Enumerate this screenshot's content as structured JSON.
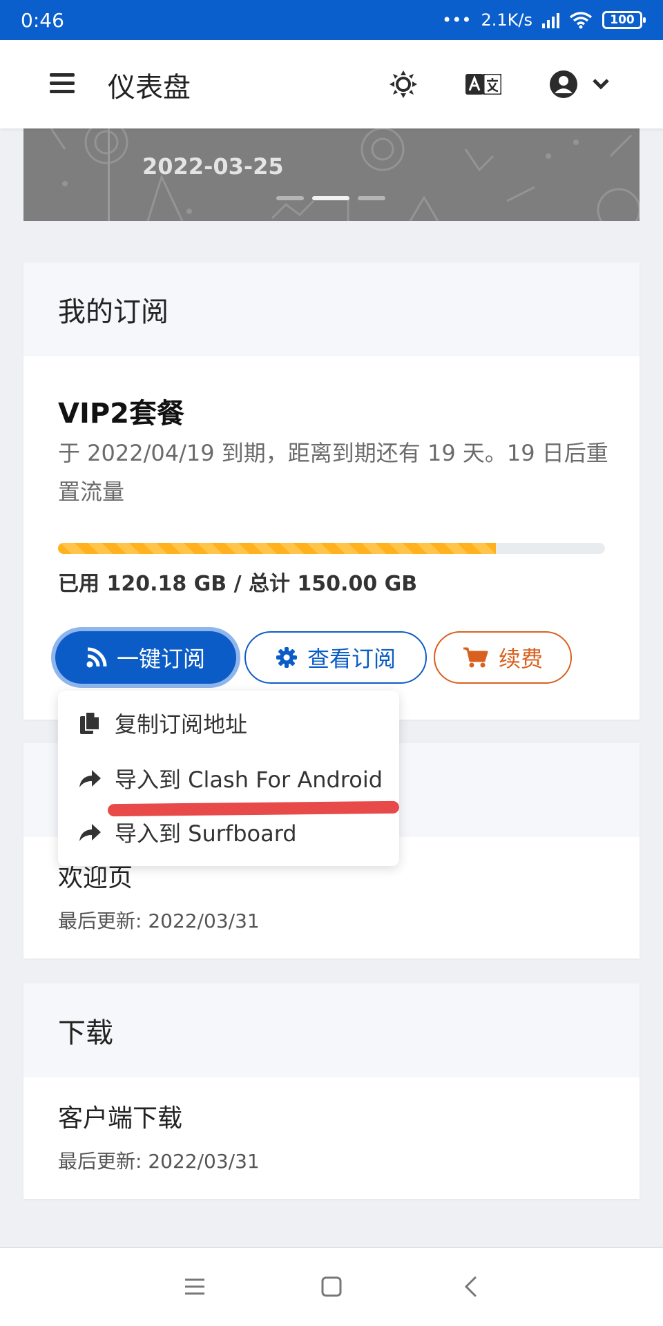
{
  "status_bar": {
    "time": "0:46",
    "network_speed": "2.1K/s",
    "battery": "100"
  },
  "header": {
    "title": "仪表盘",
    "icons": [
      "menu-icon",
      "theme-icon",
      "translate-icon",
      "user-icon",
      "chevron-down-icon"
    ]
  },
  "banner": {
    "date": "2022-03-25"
  },
  "subscription": {
    "title": "我的订阅",
    "plan_name": "VIP2套餐",
    "description": "于 2022/04/19 到期，距离到期还有 19 天。19 日后重置流量",
    "usage_text": "已用 120.18 GB / 总计 150.00 GB",
    "usage_fraction": 0.801,
    "buttons": {
      "subscribe": "一键订阅",
      "view": "查看订阅",
      "renew": "续费"
    }
  },
  "dropdown": {
    "items": [
      {
        "label": "复制订阅地址",
        "icon": "copy-icon"
      },
      {
        "label": "导入到 Clash For Android",
        "icon": "share-icon"
      },
      {
        "label": "导入到 Surfboard",
        "icon": "share-icon"
      }
    ]
  },
  "documents": {
    "item_title": "欢迎页",
    "updated": "最后更新: 2022/03/31"
  },
  "download": {
    "title": "下载",
    "item_title": "客户端下载",
    "updated": "最后更新: 2022/03/31"
  },
  "colors": {
    "primary": "#0b5cc6",
    "status_bar": "#0b5fcc",
    "renew": "#d9601e",
    "progress": "#ffb21e",
    "annotation": "#e84a4a"
  }
}
